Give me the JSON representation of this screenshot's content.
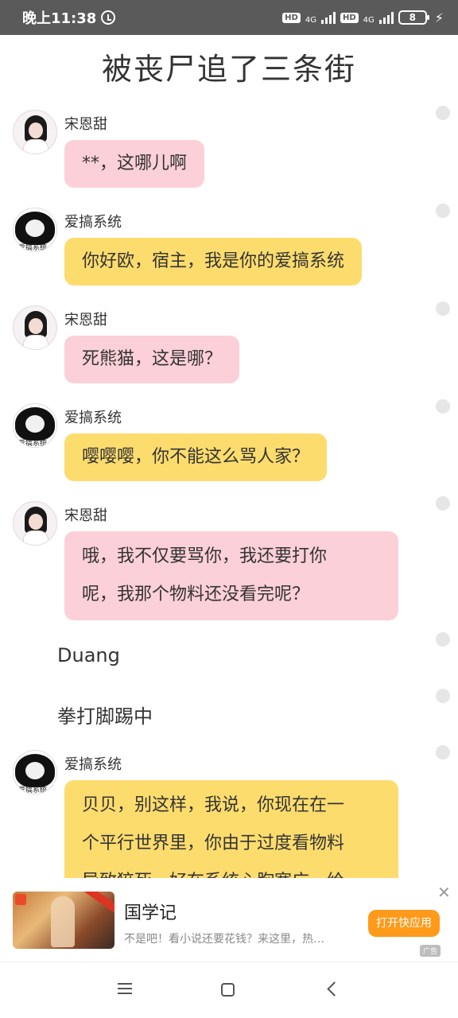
{
  "status": {
    "time": "晚上11:38",
    "hd1": "HD",
    "net1": "4G",
    "hd2": "HD",
    "net2": "4G",
    "battery": "8"
  },
  "title": "被丧尸追了三条街",
  "messages": [
    {
      "name": "宋恩甜",
      "avatar": "girl-avatar",
      "bubble_color": "#fcd0d8",
      "text": "**，这哪儿啊"
    },
    {
      "name": "爱搞系统",
      "avatar": "meme-avatar",
      "bubble_color": "#fddc6e",
      "text": "你好欧，宿主，我是你的爱搞系统"
    },
    {
      "name": "宋恩甜",
      "avatar": "girl-avatar",
      "bubble_color": "#fcd0d8",
      "text": "死熊猫，这是哪？"
    },
    {
      "name": "爱搞系统",
      "avatar": "meme-avatar",
      "bubble_color": "#fddc6e",
      "text": "嘤嘤嘤，你不能这么骂人家？"
    },
    {
      "name": "宋恩甜",
      "avatar": "girl-avatar",
      "bubble_color": "#fcd0d8",
      "text_lines": [
        "哦，我不仅要骂你，我还要打你",
        "呢，我那个物料还没看完呢？"
      ]
    },
    {
      "name": "爱搞系统",
      "avatar": "meme-avatar",
      "bubble_color": "#fddc6e",
      "text_lines": [
        "贝贝，别这样，我说，你现在在一",
        "个平行世界里，你由于过度看物料",
        "导致猝死，好在系统心胸宽广，给"
      ]
    }
  ],
  "narration": [
    "Duang",
    "拳打脚踢中"
  ],
  "meme_avatar_text": "爱搞系统",
  "ad": {
    "title": "国学记",
    "desc": "不是吧！看小说还要花钱？来这里，热…",
    "button": "打开快应用",
    "close": "✕",
    "label": "广告"
  },
  "colors": {
    "pink_bubble": "#fcd0d8",
    "yellow_bubble": "#fddc6e",
    "ad_button": "#ff9a1a"
  }
}
